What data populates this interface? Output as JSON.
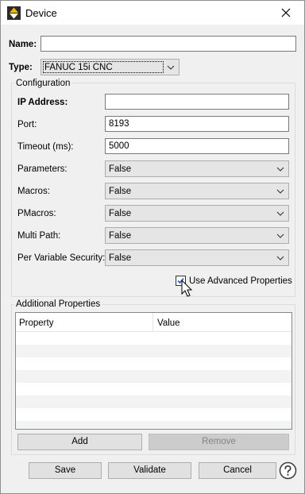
{
  "window": {
    "title": "Device"
  },
  "form": {
    "name_label": "Name:",
    "name_value": "",
    "type_label": "Type:",
    "type_value": "FANUC 15i CNC"
  },
  "configuration": {
    "title": "Configuration",
    "ip_label": "IP Address:",
    "ip_value": "",
    "port_label": "Port:",
    "port_value": "8193",
    "timeout_label": "Timeout (ms):",
    "timeout_value": "5000",
    "parameters_label": "Parameters:",
    "parameters_value": "False",
    "macros_label": "Macros:",
    "macros_value": "False",
    "pmacros_label": "PMacros:",
    "pmacros_value": "False",
    "multipath_label": "Multi Path:",
    "multipath_value": "False",
    "pervar_label": "Per Variable Security:",
    "pervar_value": "False",
    "advanced_label": "Use Advanced Properties",
    "advanced_checked": true
  },
  "additional": {
    "title": "Additional Properties",
    "columns": [
      "Property",
      "Value"
    ],
    "rows": [],
    "add_label": "Add",
    "remove_label": "Remove"
  },
  "footer": {
    "save_label": "Save",
    "validate_label": "Validate",
    "cancel_label": "Cancel"
  },
  "icons": {
    "app": "device-app-icon",
    "close": "close-icon",
    "help": "help-icon",
    "checkbox": "checkmark-icon",
    "cursor": "mouse-pointer-icon"
  }
}
